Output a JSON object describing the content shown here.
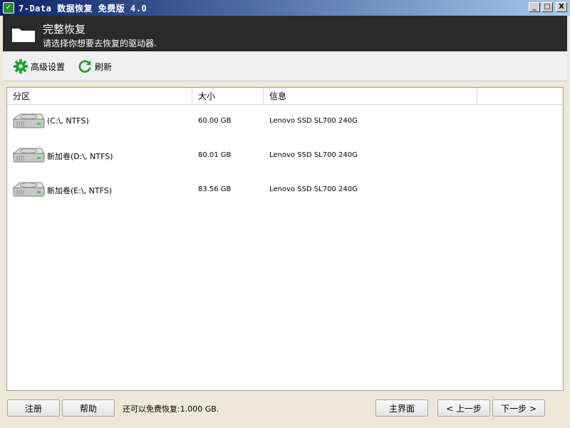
{
  "window": {
    "title": "7-Data 数据恢复 免费版 4.0",
    "icon": "app-icon",
    "controls": {
      "minimize": "_",
      "maximize": "□",
      "close": "X"
    }
  },
  "header": {
    "title": "完整恢复",
    "subtitle": "请选择你想要去恢复的驱动器.",
    "icon": "folder-icon"
  },
  "toolbar": {
    "advanced_settings_label": "高级设置",
    "refresh_label": "刷新",
    "colors": {
      "gear": "#1f9e2f",
      "refresh": "#1f9e2f"
    }
  },
  "table": {
    "columns": [
      "分区",
      "大小",
      "信息",
      ""
    ],
    "rows": [
      {
        "name": "(C:\\, NTFS)",
        "size": "60.00 GB",
        "info": "Lenovo SSD SL700 240G"
      },
      {
        "name": "新加卷(D:\\, NTFS)",
        "size": "80.01 GB",
        "info": "Lenovo SSD SL700 240G"
      },
      {
        "name": "新加卷(E:\\, NTFS)",
        "size": "83.56 GB",
        "info": "Lenovo SSD SL700 240G"
      }
    ]
  },
  "footer": {
    "register_label": "注册",
    "help_label": "帮助",
    "status_text": "还可以免费恢复:1.000 GB.",
    "main_label": "主界面",
    "prev_label": "< 上一步",
    "next_label": "下一步 >"
  }
}
